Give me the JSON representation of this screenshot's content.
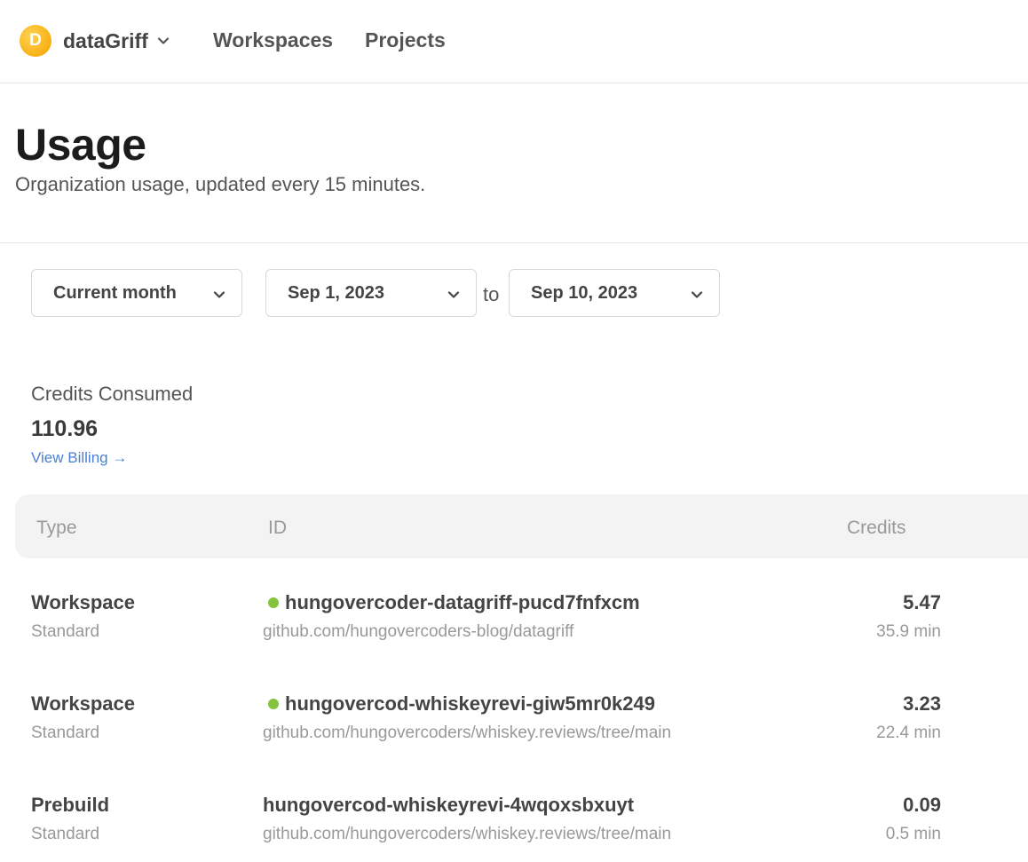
{
  "header": {
    "org_initial": "D",
    "org_name": "dataGriff",
    "nav": [
      "Workspaces",
      "Projects"
    ]
  },
  "page": {
    "title": "Usage",
    "subtitle": "Organization usage, updated every 15 minutes."
  },
  "filters": {
    "range": "Current month",
    "from": "Sep 1, 2023",
    "to_label": "to",
    "to": "Sep 10, 2023"
  },
  "credits": {
    "label": "Credits Consumed",
    "value": "110.96",
    "billing_link": "View Billing →"
  },
  "table": {
    "columns": [
      "Type",
      "ID",
      "Credits"
    ],
    "rows": [
      {
        "type": "Workspace",
        "class": "Standard",
        "id": "hungovercoder-datagriff-pucd7fnfxcm",
        "running": true,
        "repo": "github.com/hungovercoders-blog/datagriff",
        "credits": "5.47",
        "duration": "35.9 min"
      },
      {
        "type": "Workspace",
        "class": "Standard",
        "id": "hungovercod-whiskeyrevi-giw5mr0k249",
        "running": true,
        "repo": "github.com/hungovercoders/whiskey.reviews/tree/main",
        "credits": "3.23",
        "duration": "22.4 min"
      },
      {
        "type": "Prebuild",
        "class": "Standard",
        "id": "hungovercod-whiskeyrevi-4wqoxsbxuyt",
        "running": false,
        "repo": "github.com/hungovercoders/whiskey.reviews/tree/main",
        "credits": "0.09",
        "duration": "0.5 min"
      }
    ]
  },
  "colors": {
    "running_dot": "#84c43c",
    "link": "#4a7fd6",
    "avatar": "#f5a000"
  }
}
